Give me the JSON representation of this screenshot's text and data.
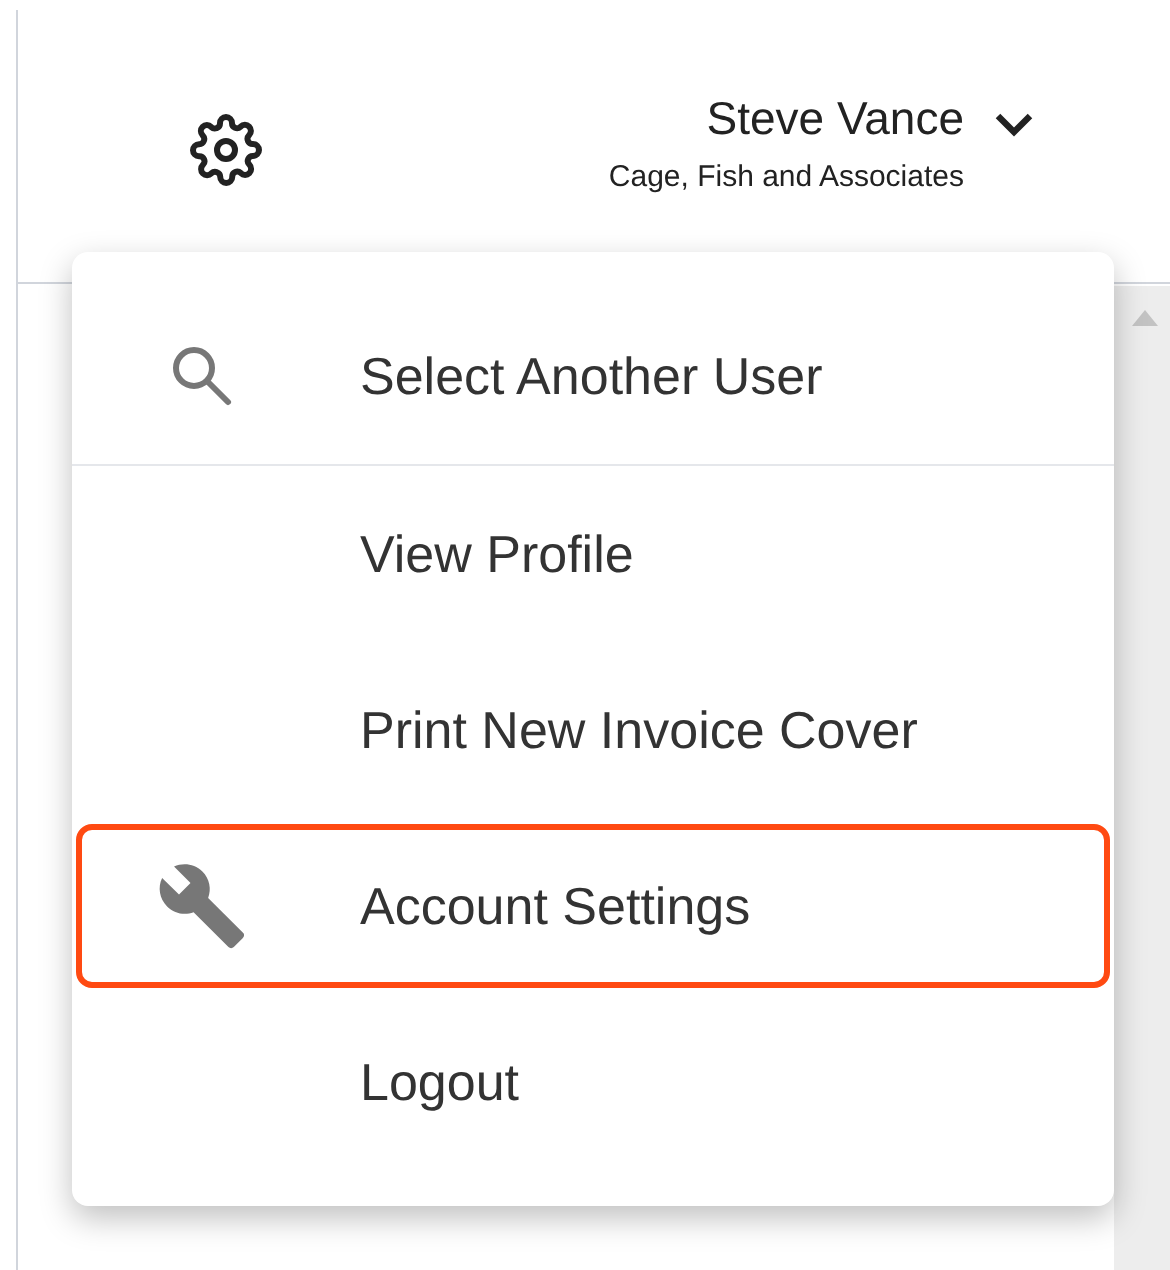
{
  "header": {
    "user_name": "Steve Vance",
    "company": "Cage, Fish and Associates"
  },
  "menu": {
    "items": [
      {
        "label": "Select Another User",
        "kind": "search",
        "divider_below": true,
        "highlighted": false
      },
      {
        "label": "View Profile",
        "kind": "plain",
        "divider_below": false,
        "highlighted": false
      },
      {
        "label": "Print New Invoice Cover",
        "kind": "plain",
        "divider_below": false,
        "highlighted": false
      },
      {
        "label": "Account Settings",
        "kind": "wrench",
        "divider_below": false,
        "highlighted": true
      },
      {
        "label": "Logout",
        "kind": "plain",
        "divider_below": false,
        "highlighted": false
      }
    ]
  }
}
